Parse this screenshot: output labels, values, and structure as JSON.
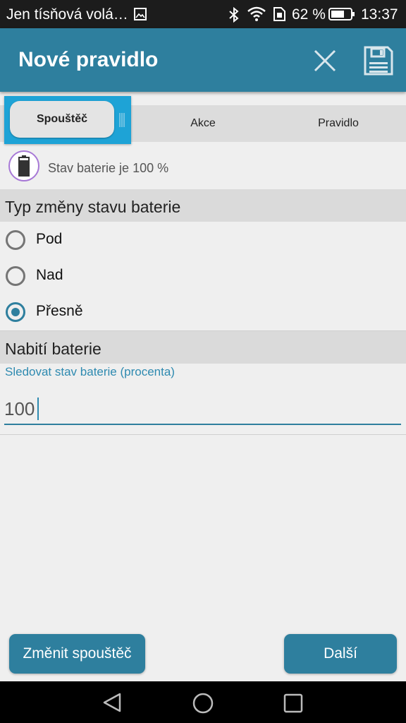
{
  "status_bar": {
    "carrier": "Jen tísňová volá…",
    "battery_percent": "62 %",
    "time": "13:37"
  },
  "app_bar": {
    "title": "Nové pravidlo"
  },
  "tabs": [
    {
      "label": "Spouštěč",
      "selected": true
    },
    {
      "label": "Akce",
      "selected": false
    },
    {
      "label": "Pravidlo",
      "selected": false
    }
  ],
  "summary": {
    "text": "Stav baterie je 100 %"
  },
  "change_type": {
    "header": "Typ změny stavu baterie",
    "options": [
      {
        "label": "Pod",
        "checked": false
      },
      {
        "label": "Nad",
        "checked": false
      },
      {
        "label": "Přesně",
        "checked": true
      }
    ]
  },
  "charge": {
    "header": "Nabití baterie",
    "hint": "Sledovat stav baterie (procenta)",
    "value": "100"
  },
  "buttons": {
    "change_trigger": "Změnit spouštěč",
    "next": "Další"
  },
  "colors": {
    "accent": "#2e7f9e",
    "tab_highlight": "#1ea3d6",
    "battery_ring": "#a778d6"
  }
}
